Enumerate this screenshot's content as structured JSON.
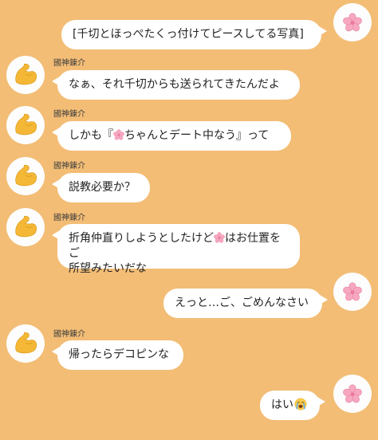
{
  "conversation": {
    "sender_name": "國神錬介",
    "messages": [
      {
        "side": "right",
        "text": "[千切とほっぺたくっ付けてピースしてる写真]"
      },
      {
        "side": "left",
        "sender": "國神錬介",
        "text": "なぁ、それ千切からも送られてきたんだよ"
      },
      {
        "side": "left",
        "sender": "國神錬介",
        "text_before": "しかも『",
        "icon": "cherry-blossom",
        "text_after": "ちゃんとデート中なう』って"
      },
      {
        "side": "left",
        "sender": "國神錬介",
        "text": "説教必要か？"
      },
      {
        "side": "left",
        "sender": "國神錬介",
        "line1_before": "折角仲直りしようとしたけど",
        "icon": "cherry-blossom",
        "line1_after": "はお仕置をご",
        "line2": "所望みたいだな"
      },
      {
        "side": "right",
        "text": "えっと…ご、ごめんなさい"
      },
      {
        "side": "left",
        "sender": "國神錬介",
        "text": "帰ったらデコピンな"
      },
      {
        "side": "right",
        "text": "はい",
        "emoji": "loudly-crying-face"
      }
    ]
  },
  "colors": {
    "background": "#F3BD76",
    "bubble": "#FFFFFF",
    "flexed_biceps": "#F5B836",
    "blossom": "#F7A8C0"
  }
}
